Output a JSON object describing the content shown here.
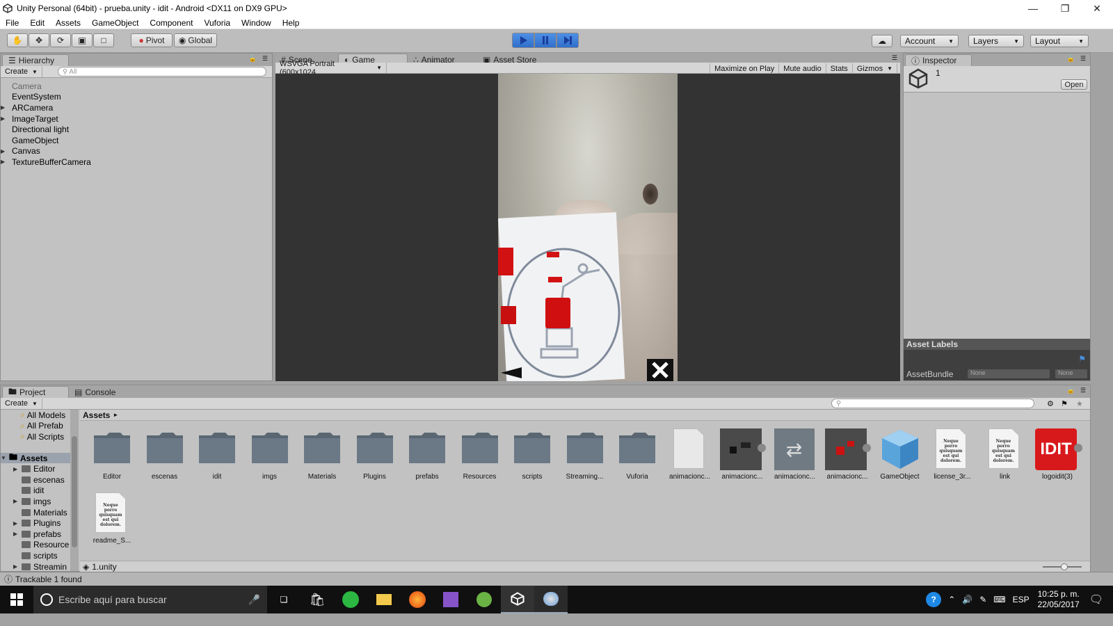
{
  "window": {
    "title": "Unity Personal (64bit) - prueba.unity - idit - Android <DX11 on DX9 GPU>"
  },
  "menu": [
    "File",
    "Edit",
    "Assets",
    "GameObject",
    "Component",
    "Vuforia",
    "Window",
    "Help"
  ],
  "toolbar": {
    "pivot_label": "Pivot",
    "global_label": "Global",
    "account_label": "Account",
    "layers_label": "Layers",
    "layout_label": "Layout"
  },
  "hierarchy": {
    "tab_label": "Hierarchy",
    "create_label": "Create",
    "search_placeholder": "All",
    "items": [
      {
        "label": "Camera",
        "expandable": false,
        "disabled": true
      },
      {
        "label": "EventSystem",
        "expandable": false,
        "disabled": false
      },
      {
        "label": "ARCamera",
        "expandable": true,
        "disabled": false
      },
      {
        "label": "ImageTarget",
        "expandable": true,
        "disabled": false
      },
      {
        "label": "Directional light",
        "expandable": false,
        "disabled": false
      },
      {
        "label": "GameObject",
        "expandable": false,
        "disabled": false
      },
      {
        "label": "Canvas",
        "expandable": true,
        "disabled": false
      },
      {
        "label": "TextureBufferCamera",
        "expandable": true,
        "disabled": false
      }
    ]
  },
  "center_tabs": [
    "Scene",
    "Game",
    "Animator",
    "Asset Store"
  ],
  "game": {
    "resolution": "WSVGA Portrait (600x1024",
    "maximize_label": "Maximize on Play",
    "mute_label": "Mute audio",
    "stats_label": "Stats",
    "gizmos_label": "Gizmos"
  },
  "inspector": {
    "tab_label": "Inspector",
    "object_name": "1",
    "open_label": "Open",
    "asset_labels_title": "Asset Labels",
    "assetbundle_label": "AssetBundle",
    "assetbundle_value": "None",
    "variant_value": "None"
  },
  "project": {
    "tab_label": "Project",
    "console_label": "Console",
    "create_label": "Create",
    "path_root": "Assets",
    "favorites": [
      "All Models",
      "All Prefab",
      "All Scripts"
    ],
    "tree_root": "Assets",
    "tree": [
      {
        "label": "Editor",
        "expandable": true
      },
      {
        "label": "escenas",
        "expandable": false
      },
      {
        "label": "idit",
        "expandable": false
      },
      {
        "label": "imgs",
        "expandable": true
      },
      {
        "label": "Materials",
        "expandable": false
      },
      {
        "label": "Plugins",
        "expandable": true
      },
      {
        "label": "prefabs",
        "expandable": true
      },
      {
        "label": "Resource",
        "expandable": false
      },
      {
        "label": "scripts",
        "expandable": false
      },
      {
        "label": "Streamin",
        "expandable": true
      }
    ],
    "folders": [
      "Editor",
      "escenas",
      "idit",
      "imgs",
      "Materials",
      "Plugins",
      "prefabs",
      "Resources",
      "scripts",
      "Streaming...",
      "Vuforia"
    ],
    "files": [
      {
        "label": "animacionc...",
        "kind": "blank"
      },
      {
        "label": "animacionc...",
        "kind": "anim-dark"
      },
      {
        "label": "animacionc...",
        "kind": "controller"
      },
      {
        "label": "animacionc...",
        "kind": "anim-red"
      },
      {
        "label": "GameObject",
        "kind": "cube"
      },
      {
        "label": "license_3r...",
        "kind": "doc"
      },
      {
        "label": "link",
        "kind": "doc"
      },
      {
        "label": "logoidit(3)",
        "kind": "logo"
      },
      {
        "label": "readme_S...",
        "kind": "doc"
      }
    ],
    "doc_text": "Neque porro quisquam est qui dolorem.",
    "logo_text": "IDIT",
    "selected_file": "1.unity"
  },
  "status": {
    "message": "Trackable 1 found"
  },
  "taskbar": {
    "search_placeholder": "Escribe aquí para buscar",
    "lang": "ESP",
    "time": "10:25 p. m.",
    "date": "22/05/2017"
  },
  "colors": {
    "play_active": "#3a7bd5",
    "idit_red": "#d8191c",
    "taskbar": "#101010"
  }
}
